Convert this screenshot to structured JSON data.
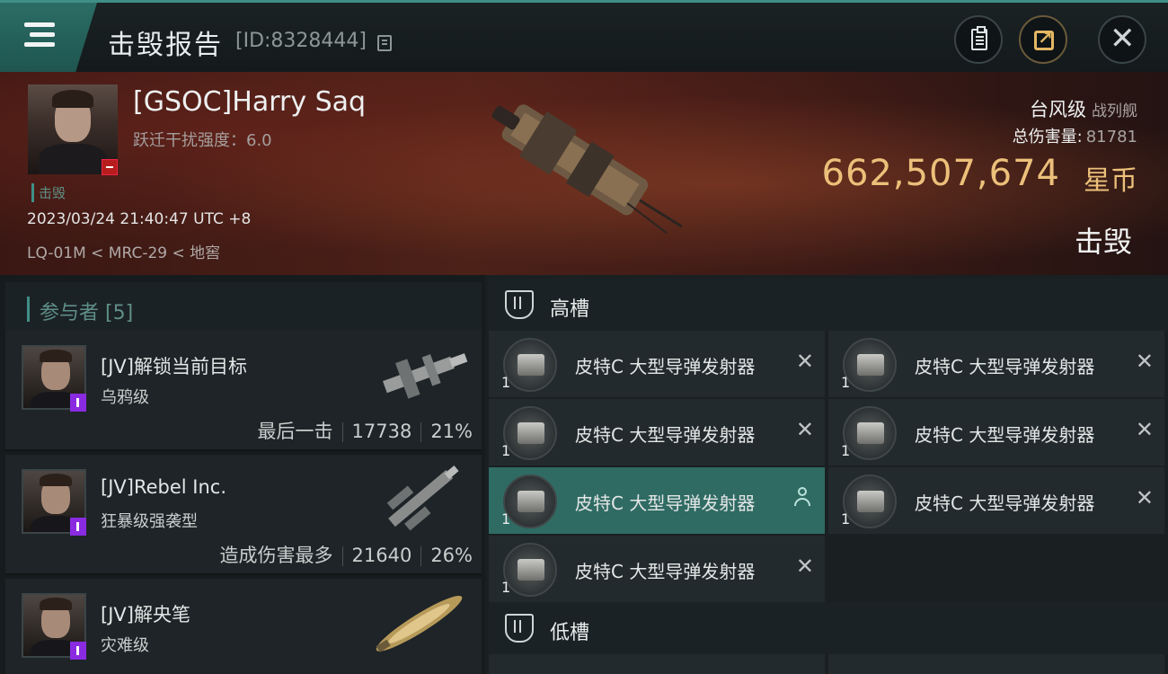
{
  "header": {
    "title": "击毁报告",
    "report_id": "[ID:8328444]"
  },
  "victim": {
    "name": "[GSOC]Harry Saq",
    "warp_strength": "跃迁干扰强度：6.0",
    "status": "击毁",
    "datetime": "2023/03/24 21:40:47 UTC +8",
    "location": "LQ-01M < MRC-29 < 地窖",
    "ship_name": "台风级",
    "ship_type": "战列舰",
    "damage_label": "总伤害量:",
    "damage_value": "81781",
    "isk_value": "662,507,674",
    "isk_unit": "星币",
    "result": "击毁"
  },
  "participants": {
    "header": "参与者 [5]",
    "items": [
      {
        "name": "[JV]解锁当前目标",
        "ship": "乌鸦级",
        "role": "最后一击",
        "damage": "17738",
        "percent": "21%"
      },
      {
        "name": "[JV]Rebel Inc.",
        "ship": "狂暴级强袭型",
        "role": "造成伤害最多",
        "damage": "21640",
        "percent": "26%"
      },
      {
        "name": "[JV]解央笔",
        "ship": "灾难级",
        "role": "",
        "damage": "",
        "percent": ""
      }
    ]
  },
  "fitting": {
    "high_slot_label": "高槽",
    "low_slot_label": "低槽",
    "modules": [
      {
        "name": "皮特C 大型导弹发射器",
        "qty": "1",
        "status": "destroyed"
      },
      {
        "name": "皮特C 大型导弹发射器",
        "qty": "1",
        "status": "destroyed"
      },
      {
        "name": "皮特C 大型导弹发射器",
        "qty": "1",
        "status": "destroyed"
      },
      {
        "name": "皮特C 大型导弹发射器",
        "qty": "1",
        "status": "destroyed"
      },
      {
        "name": "皮特C 大型导弹发射器",
        "qty": "1",
        "status": "dropped"
      },
      {
        "name": "皮特C 大型导弹发射器",
        "qty": "1",
        "status": "destroyed"
      },
      {
        "name": "皮特C 大型导弹发射器",
        "qty": "1",
        "status": "destroyed"
      }
    ]
  },
  "colors": {
    "accent": "#3f8f86",
    "isk": "#ecc07a",
    "active_row": "#2f6b63",
    "victim_badge": "#b81d1d",
    "corp_badge": "#8a2be2"
  },
  "icons": {
    "menu": "hamburger-icon",
    "copy": "copy-icon",
    "clipboard": "clipboard-icon",
    "share": "share-icon",
    "close": "close-icon",
    "slot": "shield-slot-icon",
    "destroyed": "x-icon",
    "dropped": "user-icon"
  }
}
